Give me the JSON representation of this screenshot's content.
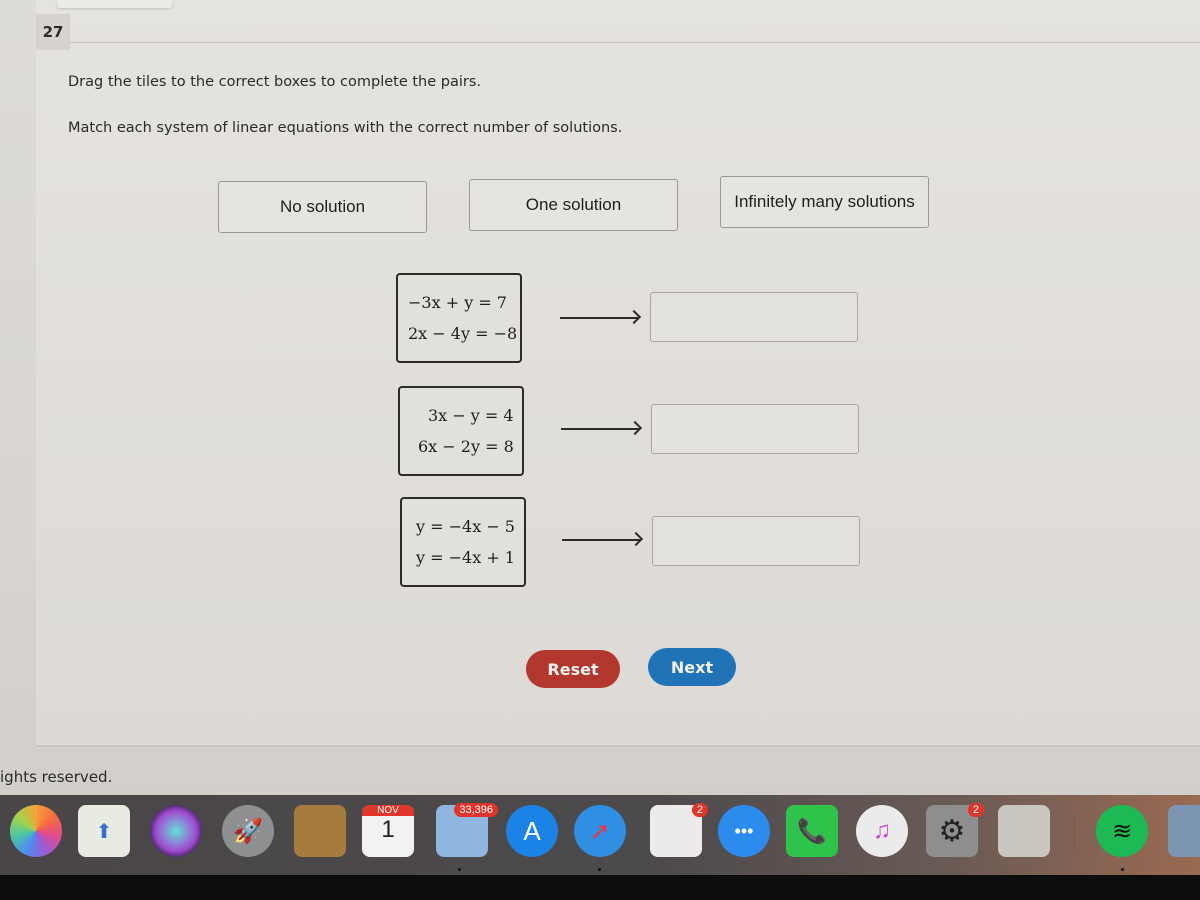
{
  "question": {
    "number": "27",
    "instruction_1": "Drag the tiles to the correct boxes to complete the pairs.",
    "instruction_2": "Match each system of linear equations with the correct number of solutions."
  },
  "tiles": [
    {
      "label": "No solution"
    },
    {
      "label": "One solution"
    },
    {
      "label": "Infinitely many solutions"
    }
  ],
  "systems": [
    {
      "eq1": "−3x + y = 7",
      "eq2": "2x − 4y = −8",
      "answer": ""
    },
    {
      "eq1": "3x − y = 4",
      "eq2": "6x − 2y = 8",
      "answer": ""
    },
    {
      "eq1": "y = −4x − 5",
      "eq2": "y = −4x + 1",
      "answer": ""
    }
  ],
  "buttons": {
    "reset": "Reset",
    "next": "Next"
  },
  "footer": "ights reserved.",
  "dock": {
    "calendar_month": "NOV",
    "calendar_day": "1",
    "mail_badge": "33,396",
    "reminders_badge": "2",
    "preferences_badge": "2"
  }
}
